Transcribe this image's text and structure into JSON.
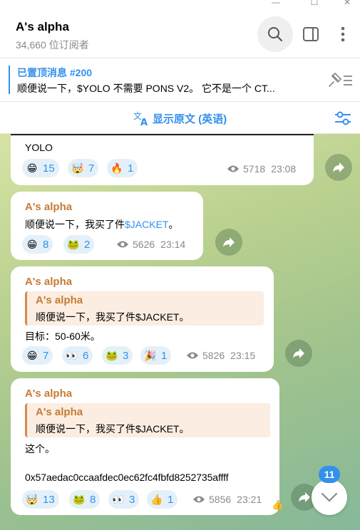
{
  "window": {
    "controls": [
      "minimize",
      "maximize",
      "close"
    ]
  },
  "header": {
    "title": "A's alpha",
    "subscribers": "34,660 位订阅者"
  },
  "pinned": {
    "title": "已置顶消息 #200",
    "text": "顺便说一下，$YOLO 不需要 PONS V2。 它不是一个 CT..."
  },
  "translate": {
    "label": "显示原文 (英语)"
  },
  "colors": {
    "accent": "#3390ec",
    "sender": "#c57b34",
    "quote_bg": "#fbede1"
  },
  "messages": [
    {
      "text": "YOLO",
      "reactions": [
        {
          "emoji": "😁",
          "count": "15"
        },
        {
          "emoji": "🤯",
          "count": "7"
        },
        {
          "emoji": "🔥",
          "count": "1"
        }
      ],
      "views": "5718",
      "time": "23:08"
    },
    {
      "sender": "A's alpha",
      "text_prefix": "顺便说一下，我买了件",
      "text_link": "$JACKET",
      "text_suffix": "。",
      "reactions": [
        {
          "emoji": "😁",
          "count": "8"
        },
        {
          "emoji": "🐸",
          "count": "2"
        }
      ],
      "views": "5626",
      "time": "23:14"
    },
    {
      "sender": "A's alpha",
      "quote": {
        "sender": "A's alpha",
        "text": "顺便说一下，我买了件$JACKET。"
      },
      "text": "目标：50-60米。",
      "reactions": [
        {
          "emoji": "😁",
          "count": "7"
        },
        {
          "emoji": "👀",
          "count": "6"
        },
        {
          "emoji": "🐸",
          "count": "3"
        },
        {
          "emoji": "🎉",
          "count": "1"
        }
      ],
      "views": "5826",
      "time": "23:15"
    },
    {
      "sender": "A's alpha",
      "quote": {
        "sender": "A's alpha",
        "text": "顺便说一下，我买了件$JACKET。"
      },
      "text": "这个。",
      "address": "0x57aedac0ccaafdec0ec62fc4fbfd8252735affff",
      "reactions": [
        {
          "emoji": "🤯",
          "count": "13"
        },
        {
          "emoji": "🐸",
          "count": "8"
        },
        {
          "emoji": "👀",
          "count": "3"
        },
        {
          "emoji": "👍",
          "count": "1"
        }
      ],
      "views": "5856",
      "time": "23:21",
      "own_reaction": "👍"
    }
  ],
  "unread_badge": "11"
}
